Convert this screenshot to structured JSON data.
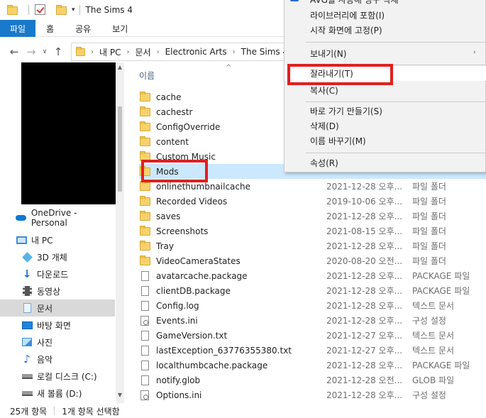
{
  "titlebar": {
    "title": "The Sims 4"
  },
  "ribbon": {
    "tabs": [
      "파일",
      "홈",
      "공유",
      "보기"
    ]
  },
  "address": {
    "crumbs": [
      "내 PC",
      "문서",
      "Electronic Arts",
      "The Sims 4"
    ]
  },
  "navpane": {
    "items": [
      {
        "label": "OneDrive - Personal",
        "icon": "onedrive-icon"
      },
      {
        "label": "내 PC",
        "icon": "pc-icon"
      },
      {
        "label": "3D 개체",
        "icon": "3d-objects-icon"
      },
      {
        "label": "다운로드",
        "icon": "download-icon"
      },
      {
        "label": "동영상",
        "icon": "video-icon"
      },
      {
        "label": "문서",
        "icon": "documents-icon",
        "selected": true
      },
      {
        "label": "바탕 화면",
        "icon": "desktop-icon"
      },
      {
        "label": "사진",
        "icon": "pictures-icon"
      },
      {
        "label": "음악",
        "icon": "music-icon"
      },
      {
        "label": "로컬 디스크 (C:)",
        "icon": "drive-icon"
      },
      {
        "label": "새 볼륨 (D:)",
        "icon": "drive-icon"
      }
    ]
  },
  "filelist": {
    "column_name": "이름",
    "files": [
      {
        "name": "cache",
        "date": "",
        "type": "",
        "kind": "folder"
      },
      {
        "name": "cachestr",
        "date": "",
        "type": "",
        "kind": "folder"
      },
      {
        "name": "ConfigOverride",
        "date": "",
        "type": "",
        "kind": "folder"
      },
      {
        "name": "content",
        "date": "",
        "type": "",
        "kind": "folder"
      },
      {
        "name": "Custom Music",
        "date": "",
        "type": "",
        "kind": "folder"
      },
      {
        "name": "Mods",
        "date": "",
        "type": "",
        "kind": "folder",
        "selected": true
      },
      {
        "name": "onlinethumbnailcache",
        "date": "2021-12-28 오후...",
        "type": "파일 폴더",
        "kind": "folder"
      },
      {
        "name": "Recorded Videos",
        "date": "2019-10-06 오후...",
        "type": "파일 폴더",
        "kind": "folder"
      },
      {
        "name": "saves",
        "date": "2021-12-28 오후...",
        "type": "파일 폴더",
        "kind": "folder"
      },
      {
        "name": "Screenshots",
        "date": "2021-08-15 오후...",
        "type": "파일 폴더",
        "kind": "folder"
      },
      {
        "name": "Tray",
        "date": "2021-12-28 오후...",
        "type": "파일 폴더",
        "kind": "folder"
      },
      {
        "name": "VideoCameraStates",
        "date": "2020-08-20 오전...",
        "type": "파일 폴더",
        "kind": "folder"
      },
      {
        "name": "avatarcache.package",
        "date": "2021-12-28 오후...",
        "type": "PACKAGE 파일",
        "kind": "doc"
      },
      {
        "name": "clientDB.package",
        "date": "2021-12-28 오후...",
        "type": "PACKAGE 파일",
        "kind": "doc"
      },
      {
        "name": "Config.log",
        "date": "2021-12-28 오후...",
        "type": "텍스트 문서",
        "kind": "doc"
      },
      {
        "name": "Events.ini",
        "date": "2021-12-28 오후...",
        "type": "구성 설정",
        "kind": "ini"
      },
      {
        "name": "GameVersion.txt",
        "date": "2021-12-27 오후...",
        "type": "텍스트 문서",
        "kind": "doc"
      },
      {
        "name": "lastException_63776355380.txt",
        "date": "2021-12-27 오후...",
        "type": "텍스트 문서",
        "kind": "doc"
      },
      {
        "name": "localthumbcache.package",
        "date": "2021-12-28 오후...",
        "type": "PACKAGE 파일",
        "kind": "doc"
      },
      {
        "name": "notify.glob",
        "date": "2021-12-28 오전...",
        "type": "GLOB 파일",
        "kind": "doc"
      },
      {
        "name": "Options.ini",
        "date": "2021-12-28 오후...",
        "type": "구성 설정",
        "kind": "ini"
      }
    ]
  },
  "statusbar": {
    "count": "25개 항목",
    "selection": "1개 항목 선택함"
  },
  "contextmenu": {
    "items": [
      {
        "label": "AVG를 사용해 영구 삭제",
        "group": 1
      },
      {
        "label": "라이브러리에 포함(I)",
        "group": 1
      },
      {
        "label": "시작 화면에 고정(P)",
        "group": 1
      },
      {
        "label": "보내기(N)",
        "group": 2
      },
      {
        "label": "잘라내기(T)",
        "group": 3,
        "hover": true
      },
      {
        "label": "복사(C)",
        "group": 3
      },
      {
        "label": "바로 가기 만들기(S)",
        "group": 4
      },
      {
        "label": "삭제(D)",
        "group": 4
      },
      {
        "label": "이름 바꾸기(M)",
        "group": 4
      },
      {
        "label": "속성(R)",
        "group": 5
      }
    ]
  },
  "colors": {
    "accent": "#1979ca",
    "selection": "#cce8ff",
    "highlight_box": "#e02020"
  }
}
